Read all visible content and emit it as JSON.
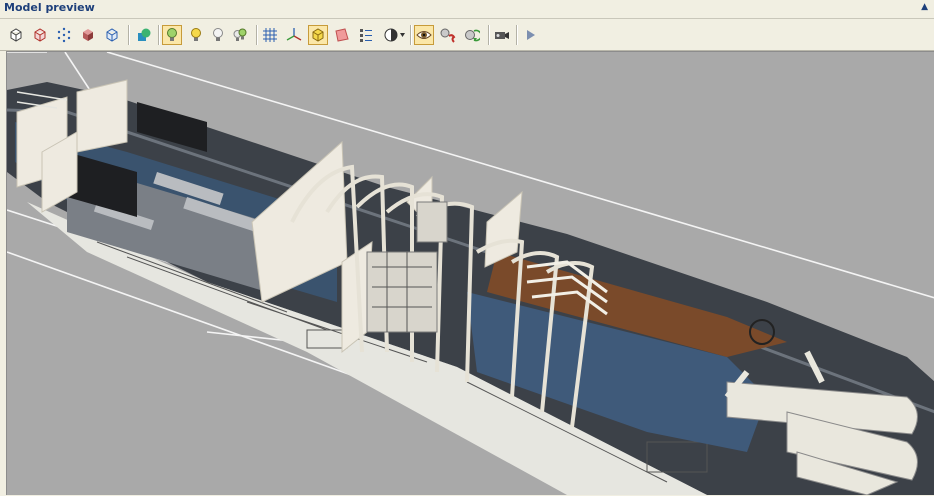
{
  "panel": {
    "title": "Model preview",
    "collapse_icon": "triangle-up-icon"
  },
  "toolbar": {
    "buttons": [
      {
        "name": "view-front-button",
        "icon": "cube-wire-icon",
        "active": false
      },
      {
        "name": "view-side-button",
        "icon": "cube-red-icon",
        "active": false
      },
      {
        "name": "view-points-button",
        "icon": "points-icon",
        "active": false
      },
      {
        "name": "view-solid-button",
        "icon": "cube-solid-icon",
        "active": false
      },
      {
        "name": "view-bounds-button",
        "icon": "cube-blue-icon",
        "active": false
      },
      {
        "name": "shapes-button",
        "icon": "shapes-icon",
        "active": false
      },
      {
        "name": "light-1-button",
        "icon": "bulb-green-icon",
        "active": true
      },
      {
        "name": "light-2-button",
        "icon": "bulb-yellow-icon",
        "active": false
      },
      {
        "name": "light-3-button",
        "icon": "bulb-white-icon",
        "active": false
      },
      {
        "name": "light-multi-button",
        "icon": "bulb-multi-icon",
        "active": false
      },
      {
        "name": "grid-button",
        "icon": "grid-icon",
        "active": false
      },
      {
        "name": "axes-button",
        "icon": "axes-icon",
        "active": false
      },
      {
        "name": "bounding-box-button",
        "icon": "box-yellow-icon",
        "active": true
      },
      {
        "name": "faces-button",
        "icon": "face-red-icon",
        "active": false
      },
      {
        "name": "normals-button",
        "icon": "normals-icon",
        "active": false
      },
      {
        "name": "shading-dropdown",
        "icon": "shading-icon",
        "active": false
      },
      {
        "name": "eye-button",
        "icon": "eye-icon",
        "active": true
      },
      {
        "name": "animation-button",
        "icon": "anim-icon",
        "active": false
      },
      {
        "name": "refresh-button",
        "icon": "refresh-icon",
        "active": false
      },
      {
        "name": "camera-button",
        "icon": "camera-icon",
        "active": false
      },
      {
        "name": "play-button",
        "icon": "play-icon",
        "active": false
      }
    ]
  },
  "viewport": {
    "background": "#a9a9a9",
    "hull_color": "#3a3f45",
    "cargo_color": "#3f5a7a",
    "rust_color": "#7a4a2a",
    "rib_color": "#e6e2d6"
  }
}
